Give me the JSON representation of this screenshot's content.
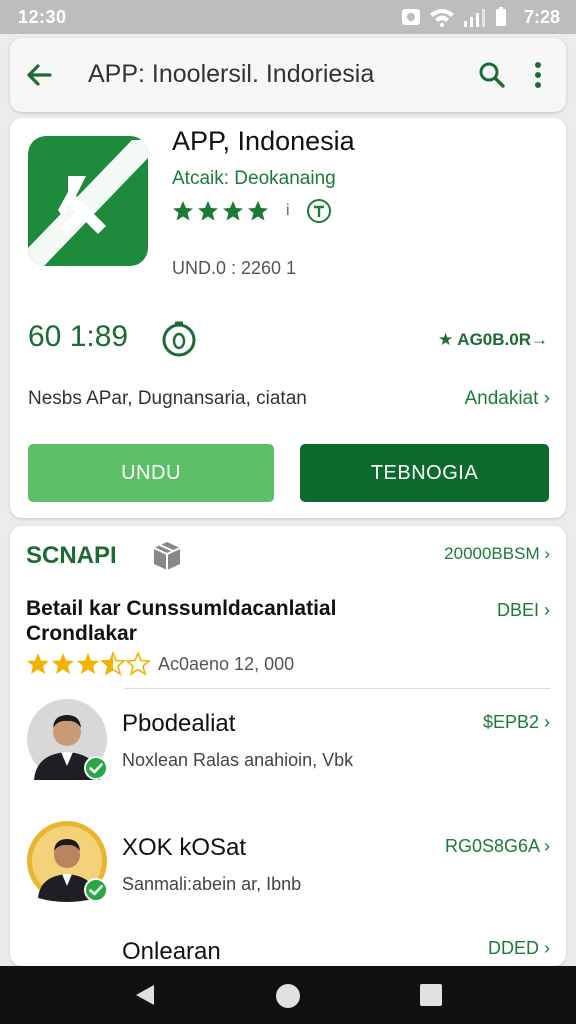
{
  "status_bar": {
    "time_left": "12:30",
    "time_right": "7:28"
  },
  "app_bar": {
    "title": "APP: Inoolersil. Indoriesia",
    "icons": [
      "back-arrow-icon",
      "search-icon",
      "more-vert-icon"
    ]
  },
  "app": {
    "name": "APP, Indonesia",
    "developer": "Atcaik: Deokanaing",
    "rating_stars": 4,
    "info_dot": "i",
    "meta": "UND.0 : 2260   1",
    "stat_main": "60 1:89",
    "stat_right": "★ AG0B.0R→",
    "description": "Nesbs APar, Dugnansaria, ciatan",
    "description_link": "Andakiat  ›",
    "btn_primary": "UNDU",
    "btn_secondary": "TEBNOGIA",
    "accent_color": "#1e8a3c"
  },
  "section": {
    "title": "SCNAPI",
    "link": "20000BBSM  ›",
    "featured_title": "Betail kar Cunssumldacanlatial Crondlakar",
    "featured_link": "DBEI  ›",
    "featured_rating_stars": 3.5,
    "featured_count": "Ac0aeno  12, 000",
    "rows": [
      {
        "name": "Pbodealiat",
        "sub": "Noxlean Ralas anahioin, Vbk",
        "link": "$EPB2  ›"
      },
      {
        "name": "XOK kOSat",
        "sub": "Sanmali:abein ar, Ibnb",
        "link": "RG0S8G6A  ›"
      },
      {
        "name": "Onlearan",
        "sub": "",
        "link": "DDED  ›"
      }
    ]
  },
  "nav_bar": {
    "icons": [
      "nav-back-icon",
      "nav-home-icon",
      "nav-recents-icon"
    ]
  }
}
